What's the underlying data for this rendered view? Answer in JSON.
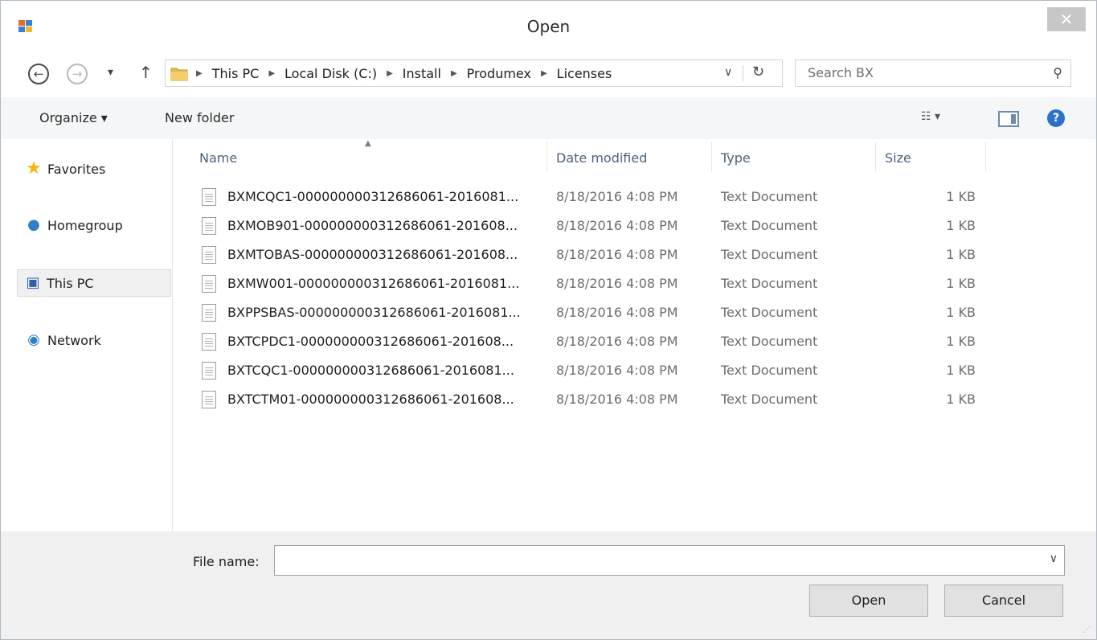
{
  "window": {
    "title": "Open",
    "close_glyph": "✕"
  },
  "nav": {
    "back_glyph": "←",
    "forward_glyph": "→",
    "recent_glyph": "▾",
    "up_glyph": "↑",
    "breadcrumbs": [
      "This PC",
      "Local Disk (C:)",
      "Install",
      "Produmex",
      "Licenses"
    ],
    "crumb_separator": "▶",
    "address_dropdown_glyph": "∨",
    "refresh_glyph": "↻",
    "search_placeholder": "Search BX",
    "search_glyph": "⚲"
  },
  "toolbar": {
    "organize_label": "Organize ▾",
    "new_folder_label": "New folder",
    "view_glyph": "☷ ▾",
    "help_glyph": "?"
  },
  "sidebar": {
    "items": [
      {
        "label": "Favorites",
        "icon": "star-icon",
        "glyph": "★",
        "color": "#f5b60e"
      },
      {
        "label": "Homegroup",
        "icon": "homegroup-icon",
        "glyph": "●",
        "color": "#2f7fc2"
      },
      {
        "label": "This PC",
        "icon": "computer-icon",
        "glyph": "▣",
        "color": "#2f5fa8"
      },
      {
        "label": "Network",
        "icon": "network-icon",
        "glyph": "◉",
        "color": "#2f7fc2"
      }
    ]
  },
  "columns": {
    "name": "Name",
    "date": "Date modified",
    "type": "Type",
    "size": "Size",
    "sort_glyph": "▲"
  },
  "files": [
    {
      "name": "BXMCQC1-000000000312686061-2016081...",
      "date": "8/18/2016 4:08 PM",
      "type": "Text Document",
      "size": "1 KB"
    },
    {
      "name": "BXMOB901-000000000312686061-201608...",
      "date": "8/18/2016 4:08 PM",
      "type": "Text Document",
      "size": "1 KB"
    },
    {
      "name": "BXMTOBAS-000000000312686061-201608...",
      "date": "8/18/2016 4:08 PM",
      "type": "Text Document",
      "size": "1 KB"
    },
    {
      "name": "BXMW001-000000000312686061-2016081...",
      "date": "8/18/2016 4:08 PM",
      "type": "Text Document",
      "size": "1 KB"
    },
    {
      "name": "BXPPSBAS-000000000312686061-2016081...",
      "date": "8/18/2016 4:08 PM",
      "type": "Text Document",
      "size": "1 KB"
    },
    {
      "name": "BXTCPDC1-000000000312686061-201608...",
      "date": "8/18/2016 4:08 PM",
      "type": "Text Document",
      "size": "1 KB"
    },
    {
      "name": "BXTCQC1-000000000312686061-2016081...",
      "date": "8/18/2016 4:08 PM",
      "type": "Text Document",
      "size": "1 KB"
    },
    {
      "name": "BXTCTM01-000000000312686061-201608...",
      "date": "8/18/2016 4:08 PM",
      "type": "Text Document",
      "size": "1 KB"
    }
  ],
  "footer": {
    "file_name_label": "File name:",
    "file_name_value": "",
    "dropdown_glyph": "∨",
    "open_label": "Open",
    "cancel_label": "Cancel",
    "grip_glyph": "⋰"
  }
}
